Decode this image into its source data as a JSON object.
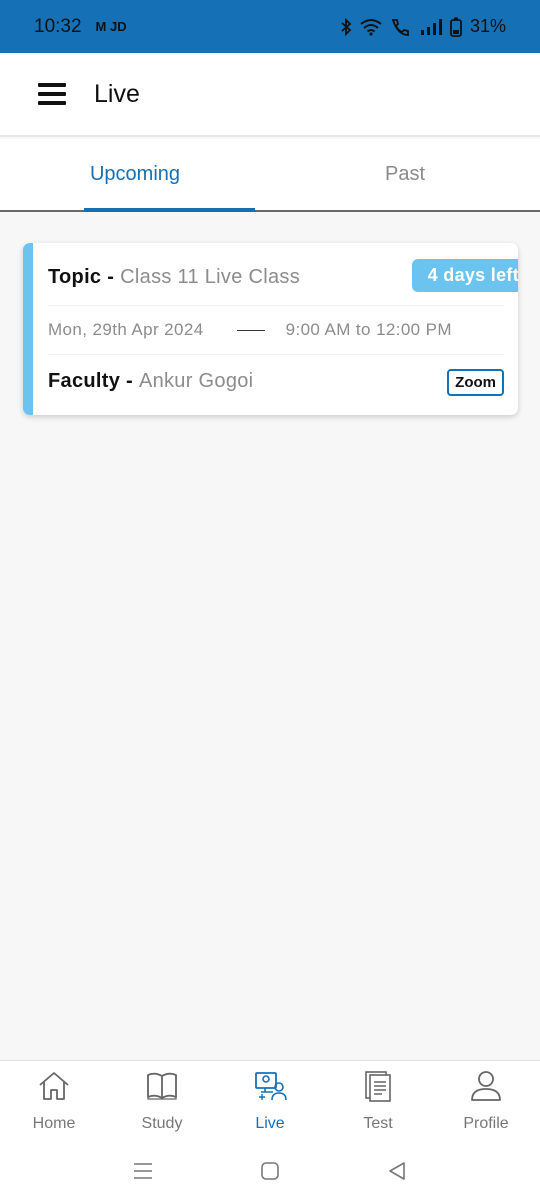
{
  "status_bar": {
    "time": "10:32",
    "carrier_icons": "M JD",
    "battery": "31%"
  },
  "header": {
    "title": "Live",
    "menu_icon": "hamburger-icon"
  },
  "tabs": [
    {
      "label": "Upcoming",
      "active": true
    },
    {
      "label": "Past",
      "active": false
    }
  ],
  "card": {
    "topic_label": "Topic -",
    "topic_value": "Class 11 Live Class",
    "badge": "4 days left",
    "date": "Mon, 29th Apr 2024",
    "time": "9:00 AM to 12:00 PM",
    "faculty_label": "Faculty -",
    "faculty_value": "Ankur Gogoi",
    "platform": "Zoom"
  },
  "bottom_nav": [
    {
      "label": "Home",
      "icon": "home-icon",
      "active": false
    },
    {
      "label": "Study",
      "icon": "book-icon",
      "active": false
    },
    {
      "label": "Live",
      "icon": "live-class-icon",
      "active": true
    },
    {
      "label": "Test",
      "icon": "test-icon",
      "active": false
    },
    {
      "label": "Profile",
      "icon": "person-icon",
      "active": false
    }
  ],
  "colors": {
    "primary": "#1670b5",
    "accent": "#6bc4ef",
    "muted_text": "#8c8c8c"
  }
}
